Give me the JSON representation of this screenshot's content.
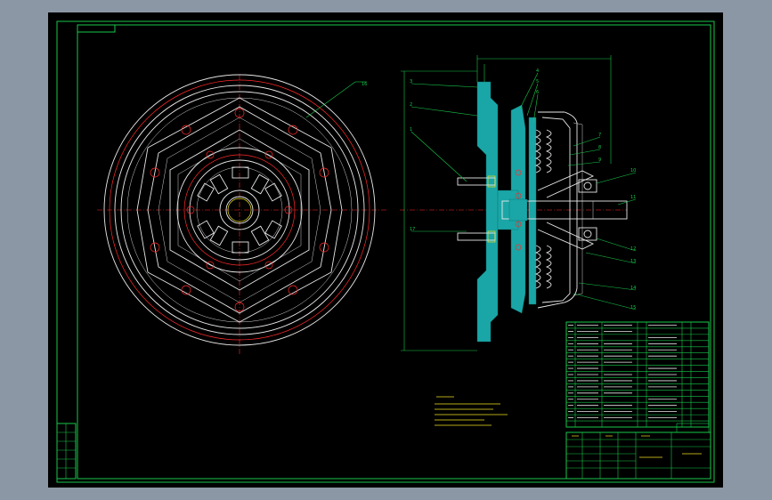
{
  "drawing": {
    "palette": {
      "frame": "#8c97a5",
      "background": "#000000",
      "line": "#17c84a",
      "outline": "#e8e8e8",
      "centerline": "#ff2a2a",
      "section_fill": "#1aa6a6",
      "highlight": "#f0e020"
    },
    "callouts": [
      "3",
      "2",
      "1",
      "17",
      "4",
      "5",
      "6",
      "7",
      "8",
      "9",
      "10",
      "11",
      "12",
      "13",
      "14",
      "15",
      "16"
    ]
  }
}
